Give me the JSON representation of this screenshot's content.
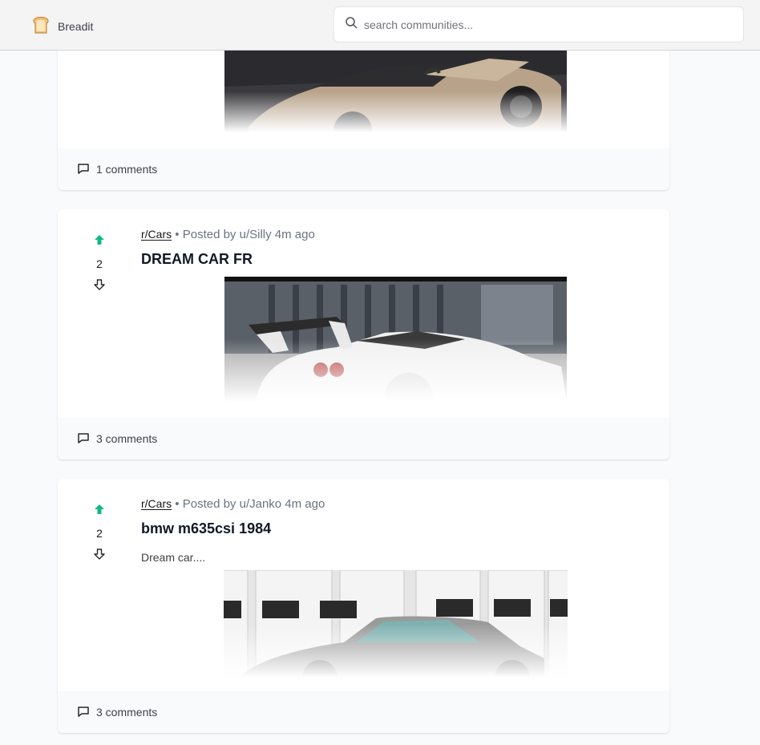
{
  "app": {
    "name": "Breadit"
  },
  "search": {
    "placeholder": "search communities..."
  },
  "posts": [
    {
      "comments_label": "1 comments"
    },
    {
      "subreddit": "r/Cars",
      "separator": "•",
      "posted_by": "Posted by u/Silly 4m ago",
      "title": "DREAM CAR FR",
      "votes": "2",
      "comments_label": "3 comments"
    },
    {
      "subreddit": "r/Cars",
      "separator": "•",
      "posted_by": "Posted by u/Janko 4m ago",
      "title": "bmw m635csi 1984",
      "body": "Dream car....",
      "votes": "2",
      "comments_label": "3 comments"
    }
  ],
  "colors": {
    "upvote": "#10b981",
    "navbar": "#f4f4f5",
    "background": "#f9fafb"
  }
}
